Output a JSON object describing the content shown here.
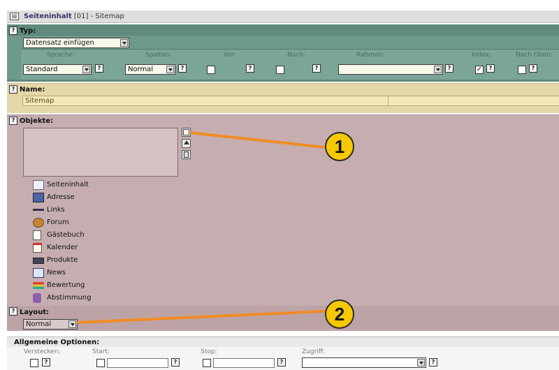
{
  "window": {
    "title_bold": "Seiteninhalt",
    "title_rest": " [01] - Sitemap"
  },
  "typ": {
    "title": "Typ:",
    "datensatz_select": "Datensatz einfügen",
    "labels": {
      "sprache": "Sprache:",
      "spalten": "Spalten:",
      "vor": "Vor:",
      "nach": "Nach:",
      "rahmen": "Rahmen:",
      "index": "Index:",
      "nach_oben": "Nach Oben:"
    },
    "sprache_value": "Standard",
    "spalten_value": "Normal",
    "rahmen_value": "",
    "index_checked": "✓"
  },
  "name": {
    "title": "Name:",
    "value": "Sitemap"
  },
  "objekte": {
    "title": "Objekte:",
    "items": [
      {
        "label": "Seiteninhalt",
        "icon": "page-content-icon"
      },
      {
        "label": "Adresse",
        "icon": "address-icon"
      },
      {
        "label": "Links",
        "icon": "links-icon"
      },
      {
        "label": "Forum",
        "icon": "forum-icon"
      },
      {
        "label": "Gästebuch",
        "icon": "guestbook-icon"
      },
      {
        "label": "Kalender",
        "icon": "calendar-icon"
      },
      {
        "label": "Produkte",
        "icon": "products-icon"
      },
      {
        "label": "News",
        "icon": "news-icon"
      },
      {
        "label": "Bewertung",
        "icon": "rating-icon"
      },
      {
        "label": "Abstimmung",
        "icon": "voting-icon"
      }
    ]
  },
  "layout": {
    "title": "Layout:",
    "value": "Normal"
  },
  "allgemein": {
    "title": "Allgemeine Optionen:",
    "labels": {
      "verstecken": "Verstecken:",
      "start": "Start:",
      "stop": "Stop:",
      "zugriff": "Zugriff:"
    }
  },
  "help_glyph": "?",
  "callouts": [
    "1",
    "2"
  ],
  "colors": {
    "callout_fill": "#f5c800",
    "callout_line": "#ef8d25",
    "typ_bg": "#6e9a8d",
    "name_bg": "#e4d7a8",
    "objekte_bg": "#c6aeb0"
  }
}
